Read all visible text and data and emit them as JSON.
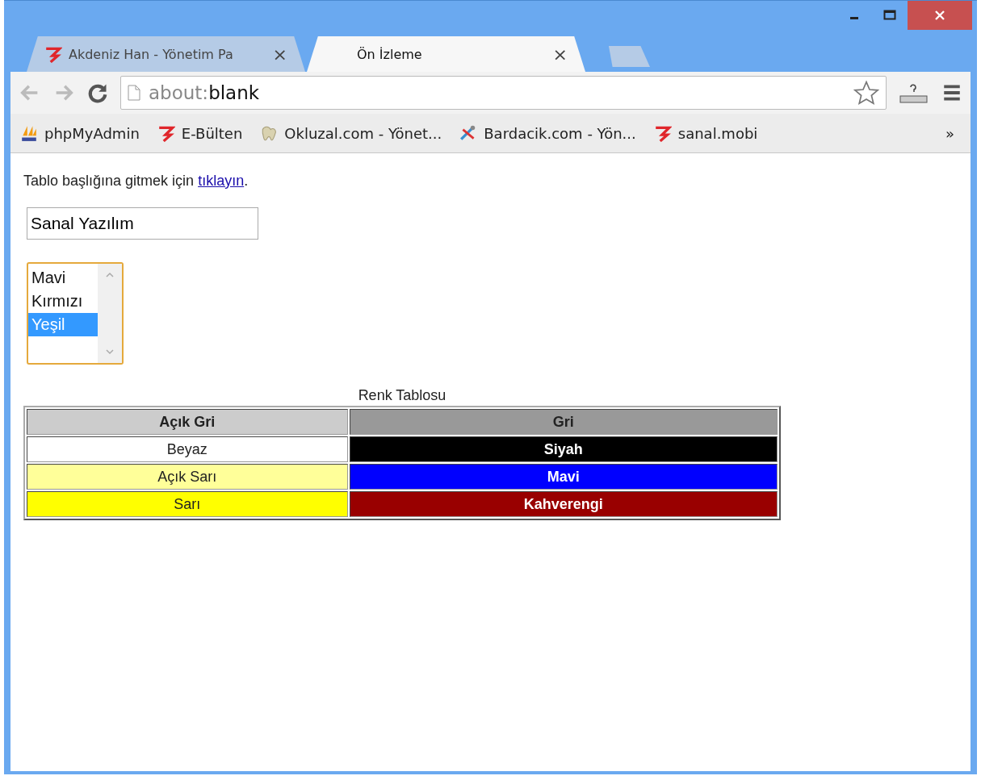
{
  "tabs": [
    {
      "title": "Akdeniz Han - Yönetim Pa",
      "close": "×",
      "selected": false,
      "kind": "logo"
    },
    {
      "title": "Ön İzleme",
      "close": "×",
      "selected": true,
      "kind": "plain"
    }
  ],
  "address": {
    "scheme": "about:",
    "rest": "blank"
  },
  "bookmarks": [
    {
      "label": "phpMyAdmin",
      "kind": "pma"
    },
    {
      "label": "E-Bülten",
      "kind": "logo"
    },
    {
      "label": "Okluzal.com - Yönet...",
      "kind": "tooth"
    },
    {
      "label": "Bardacik.com - Yön...",
      "kind": "tools"
    },
    {
      "label": "sanal.mobi",
      "kind": "logo"
    }
  ],
  "bookmarks_more": "»",
  "page": {
    "intro": "Tablo başlığına gitmek için ",
    "link": "tıklayın",
    "after": ".",
    "text_field": {
      "value": "Sanal Yazılım"
    },
    "list": [
      {
        "label": "Mavi",
        "selected": false
      },
      {
        "label": "Kırmızı",
        "selected": false
      },
      {
        "label": "Yeşil",
        "selected": true
      }
    ],
    "table": {
      "caption": "Renk Tablosu",
      "header": [
        {
          "text": "Açık Gri",
          "color": "#cccccc"
        },
        {
          "text": "Gri",
          "color": "#999999"
        }
      ],
      "rows": [
        [
          {
            "text": "Beyaz",
            "color": "#ffffff"
          },
          {
            "text": "Siyah",
            "color": "#000000"
          }
        ],
        [
          {
            "text": "Açık Sarı",
            "color": "#ffff99"
          },
          {
            "text": "Mavi",
            "color": "#0000ff"
          }
        ],
        [
          {
            "text": "Sarı",
            "color": "#ffff00"
          },
          {
            "text": "Kahverengi",
            "color": "#990000"
          }
        ]
      ]
    }
  }
}
